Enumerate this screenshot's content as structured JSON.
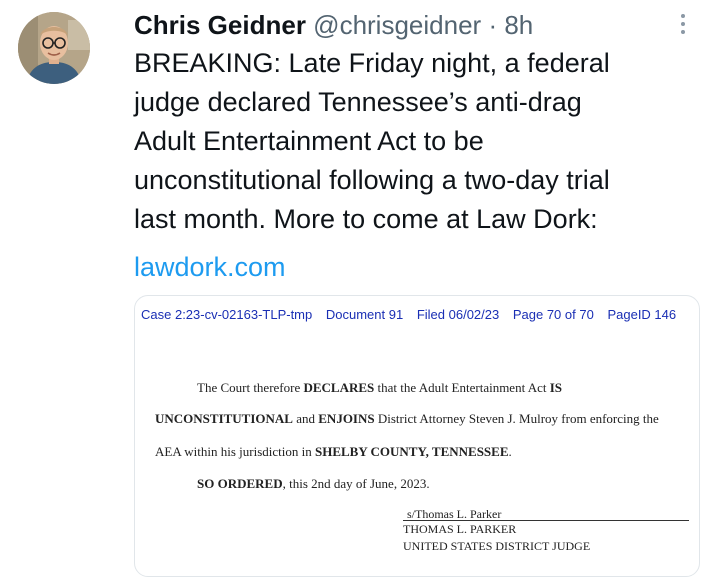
{
  "tweet": {
    "author_name": "Chris Geidner",
    "handle": "@chrisgeidner",
    "separator": "·",
    "time": "8h",
    "text_lines": [
      "BREAKING: Late Friday night, a federal",
      "judge declared Tennessee’s anti-drag",
      "Adult Entertainment Act to be",
      "unconstitutional following a two-day trial",
      "last month. More to come at Law Dork:"
    ],
    "link": "lawdork.com"
  },
  "document": {
    "header": {
      "case": "Case 2:23-cv-02163-TLP-tmp",
      "document": "Document 91",
      "filed": "Filed 06/02/23",
      "page": "Page 70 of 70",
      "pageid": "PageID 146"
    },
    "line1_prefix": "The Court therefore ",
    "line1_bold1": "DECLARES",
    "line1_mid": " that the Adult Entertainment Act ",
    "line1_bold2": "IS",
    "line2_bold1": "UNCONSTITUTIONAL",
    "line2_mid1": " and ",
    "line2_bold2": "ENJOINS",
    "line2_rest": " District Attorney Steven J. Mulroy from enforcing the",
    "line3_prefix": "AEA within his jurisdiction in ",
    "line3_bold": "SHELBY COUNTY, TENNESSEE",
    "line3_suffix": ".",
    "line4_bold": "SO ORDERED",
    "line4_rest": ", this 2nd day of June, 2023.",
    "signature": "s/Thomas L. Parker",
    "signer_name": "THOMAS L. PARKER",
    "signer_title": "UNITED STATES DISTRICT JUDGE"
  },
  "icons": {
    "avatar": "profile-photo",
    "more": "more-options-icon"
  },
  "colors": {
    "link": "#1d9bf0",
    "secondary_text": "#536471",
    "doc_header": "#1a2fb4"
  }
}
